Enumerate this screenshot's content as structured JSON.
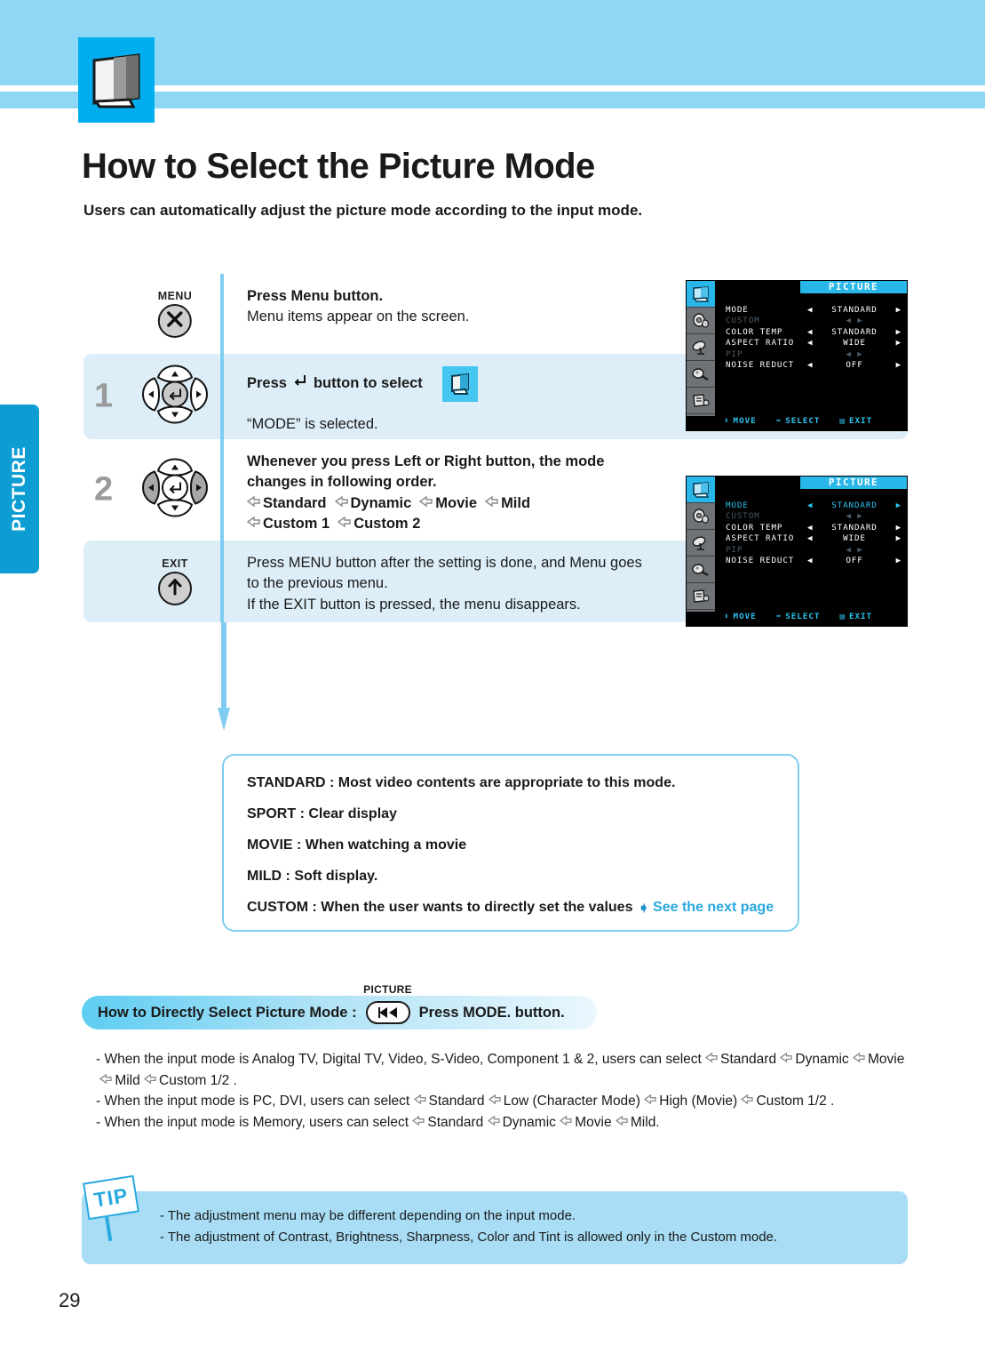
{
  "sidebar": {
    "tab_label": "PICTURE"
  },
  "header": {
    "icon": "tv-icon"
  },
  "title": "How to Select the Picture Mode",
  "subtitle": "Users can automatically adjust the picture mode according to the input mode.",
  "steps": [
    {
      "number": "",
      "button_caption": "MENU",
      "button_icon": "close-x-icon",
      "lines": [
        "Press Menu button.",
        "Menu items appear on the screen."
      ],
      "shaded": false
    },
    {
      "number": "1",
      "button_caption": "",
      "button_icon": "dpad-enter-icon",
      "press_prefix": "Press",
      "press_suffix": "button to select",
      "selected_note": "“MODE” is selected.",
      "shaded": true
    },
    {
      "number": "2",
      "button_caption": "",
      "button_icon": "dpad-left-right-icon",
      "lines": [
        "Whenever you press Left or Right button, the mode",
        "changes in following order."
      ],
      "chain_row1": [
        "Standard",
        "Dynamic",
        "Movie",
        "Mild"
      ],
      "chain_row2": [
        "Custom 1",
        "Custom 2"
      ],
      "shaded": false
    },
    {
      "number": "",
      "button_caption": "EXIT",
      "button_icon": "arrow-up-icon",
      "lines": [
        "Press MENU button after the setting is done, and Menu goes",
        "to the previous menu.",
        "If the EXIT button is pressed, the menu disappears."
      ],
      "shaded": true
    }
  ],
  "osd": {
    "title": "PICTURE",
    "icons": [
      "picture-icon",
      "sound-icon",
      "channel-icon",
      "setup-icon",
      "input-icon"
    ],
    "rows": [
      {
        "label": "MODE",
        "value": "STANDARD",
        "state": "normal"
      },
      {
        "label": "CUSTOM",
        "value": "",
        "state": "dim"
      },
      {
        "label": "COLOR TEMP",
        "value": "STANDARD",
        "state": "normal"
      },
      {
        "label": "ASPECT RATIO",
        "value": "WIDE",
        "state": "normal"
      },
      {
        "label": "PIP",
        "value": "",
        "state": "dim"
      },
      {
        "label": "NOISE REDUCT",
        "value": "OFF",
        "state": "normal"
      }
    ],
    "rows2": [
      {
        "label": "MODE",
        "value": "STANDARD",
        "state": "highlight"
      },
      {
        "label": "CUSTOM",
        "value": "",
        "state": "dim"
      },
      {
        "label": "COLOR TEMP",
        "value": "STANDARD",
        "state": "normal"
      },
      {
        "label": "ASPECT RATIO",
        "value": "WIDE",
        "state": "normal"
      },
      {
        "label": "PIP",
        "value": "",
        "state": "dim"
      },
      {
        "label": "NOISE REDUCT",
        "value": "OFF",
        "state": "normal"
      }
    ],
    "footer": [
      {
        "icon": "updown-icon",
        "label": "MOVE"
      },
      {
        "icon": "leftright-icon",
        "label": "SELECT"
      },
      {
        "icon": "menu-icon",
        "label": "EXIT"
      }
    ]
  },
  "description": {
    "lines": [
      "STANDARD : Most video contents are appropriate to this mode.",
      "SPORT : Clear display",
      "MOVIE : When watching a movie",
      "MILD : Soft display.",
      "CUSTOM : When the user wants to directly set the values"
    ],
    "next_page_link": "See the next page"
  },
  "direct_select": {
    "label": "How to Directly Select Picture Mode :",
    "button_caption": "PICTURE",
    "button_icon": "rewind-icon",
    "suffix": "Press MODE. button."
  },
  "bullets": [
    {
      "prefix": "- When the input mode is Analog TV, Digital TV, Video, S-Video, Component 1 & 2, users can select",
      "chain": [
        "Standard",
        "Dynamic",
        "Movie",
        "Mild",
        "Custom 1/2 ."
      ]
    },
    {
      "prefix": "- When the input mode is PC, DVI, users can select",
      "chain": [
        "Standard",
        "Low (Character Mode)",
        "High (Movie)",
        "Custom 1/2 ."
      ]
    },
    {
      "prefix": "- When the input mode is Memory, users can select",
      "chain": [
        "Standard",
        "Dynamic",
        "Movie",
        "Mild."
      ]
    }
  ],
  "tip": {
    "badge": "TIP",
    "lines": [
      "- The adjustment menu may be different depending on the input mode.",
      "- The adjustment of Contrast, Brightness, Sharpness, Color and Tint is allowed only in the Custom mode."
    ]
  },
  "page_number": "29",
  "colors": {
    "header_band": "#8fd8f5",
    "accent_cyan": "#00aeef",
    "tab_blue": "#0d9dd3",
    "shaded_row": "#ddeef8",
    "tip_bg": "#a8ddf5",
    "link_blue": "#29a9e0"
  }
}
